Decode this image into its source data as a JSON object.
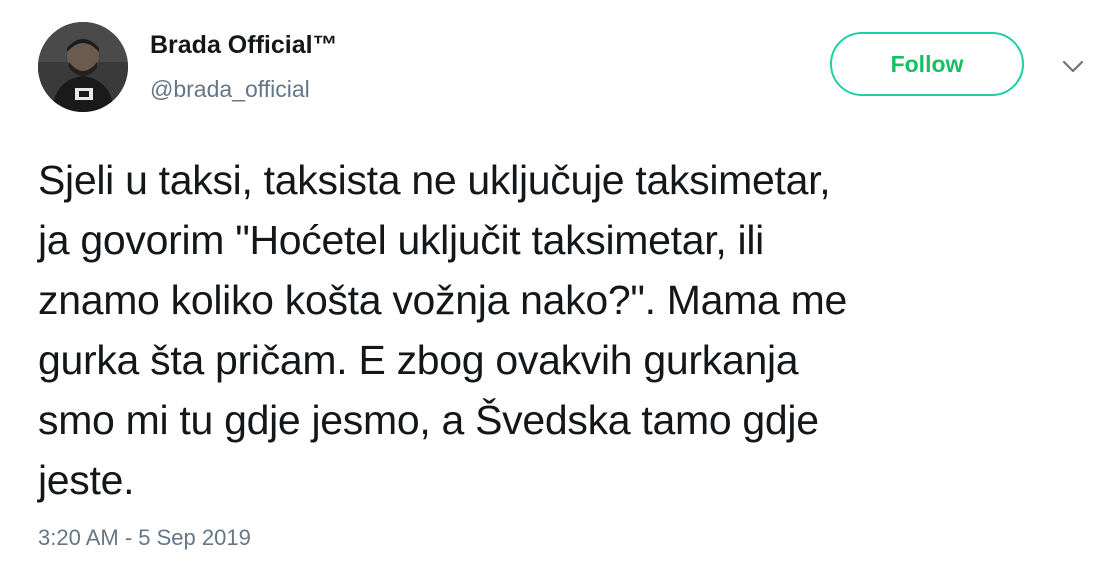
{
  "user": {
    "display_name": "Brada Official™",
    "handle": "@brada_official",
    "avatar_icon": "profile-photo"
  },
  "actions": {
    "follow_label": "Follow",
    "menu_icon": "chevron-down-icon",
    "accent_color": "#17bf63"
  },
  "tweet": {
    "text": "Sjeli u taksi, taksista ne uključuje taksimetar,\nja govorim \"Hoćetel uključit taksimetar, ili\nznamo koliko košta vožnja nako?\". Mama me\ngurka šta pričam. E zbog ovakvih gurkanja\nsmo mi tu gdje jesmo, a Švedska tamo gdje\njeste.",
    "timestamp": "3:20 AM - 5 Sep 2019"
  }
}
